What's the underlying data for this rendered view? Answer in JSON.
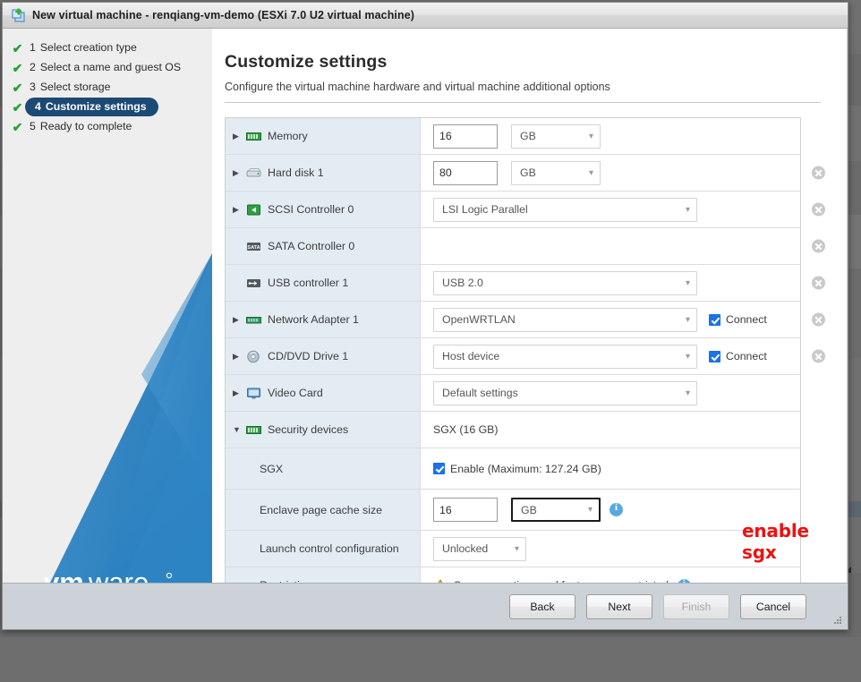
{
  "window": {
    "title": "New virtual machine - renqiang-vm-demo (ESXi 7.0 U2 virtual machine)",
    "icon": "new-virtual-machine-icon"
  },
  "nav": {
    "steps": [
      {
        "num": "1",
        "label": "Select creation type",
        "done": true,
        "active": false
      },
      {
        "num": "2",
        "label": "Select a name and guest OS",
        "done": true,
        "active": false
      },
      {
        "num": "3",
        "label": "Select storage",
        "done": true,
        "active": false
      },
      {
        "num": "4",
        "label": "Customize settings",
        "done": true,
        "active": true
      },
      {
        "num": "5",
        "label": "Ready to complete",
        "done": false,
        "active": false
      }
    ],
    "logo": "vmware",
    "logo_registered": "®"
  },
  "page": {
    "title": "Customize settings",
    "subtitle": "Configure the virtual machine hardware and virtual machine additional options"
  },
  "annotation": {
    "text": "enable sgx",
    "color": "#ee1111"
  },
  "hardware": [
    {
      "id": "memory",
      "label": "Memory",
      "icon": "memory-module-icon",
      "twisty": "collapsed",
      "control": "number-unit",
      "value": "16",
      "unit": "GB",
      "removable": false
    },
    {
      "id": "hard-disk-1",
      "label": "Hard disk 1",
      "icon": "hard-disk-icon",
      "twisty": "collapsed",
      "control": "number-unit",
      "value": "80",
      "unit": "GB",
      "removable": true
    },
    {
      "id": "scsi-controller-0",
      "label": "SCSI Controller 0",
      "icon": "scsi-controller-icon",
      "twisty": "collapsed",
      "control": "select-wide",
      "value": "LSI Logic Parallel",
      "removable": true
    },
    {
      "id": "sata-controller-0",
      "label": "SATA Controller 0",
      "icon": "sata-controller-icon",
      "twisty": "none",
      "control": "none",
      "removable": true
    },
    {
      "id": "usb-controller-1",
      "label": "USB controller 1",
      "icon": "usb-controller-icon",
      "twisty": "none",
      "control": "select-wide",
      "value": "USB 2.0",
      "removable": true
    },
    {
      "id": "network-adapter-1",
      "label": "Network Adapter 1",
      "icon": "network-adapter-icon",
      "twisty": "collapsed",
      "control": "select-connect",
      "value": "OpenWRTLAN",
      "connect_label": "Connect",
      "connect_checked": true,
      "removable": true
    },
    {
      "id": "cd-dvd-drive-1",
      "label": "CD/DVD Drive 1",
      "icon": "cd-dvd-drive-icon",
      "twisty": "collapsed",
      "control": "select-connect",
      "value": "Host device",
      "connect_label": "Connect",
      "connect_checked": true,
      "removable": true
    },
    {
      "id": "video-card",
      "label": "Video Card",
      "icon": "video-card-icon",
      "twisty": "collapsed",
      "control": "select-wide",
      "value": "Default settings",
      "removable": false
    },
    {
      "id": "security-devices",
      "label": "Security devices",
      "icon": "security-device-icon",
      "twisty": "expanded",
      "control": "plain-text",
      "value": "SGX (16 GB)",
      "removable": false
    }
  ],
  "sgx": {
    "rows": [
      {
        "id": "sgx",
        "label": "SGX",
        "control": "checkbox",
        "checkbox_label": "Enable (Maximum: 127.24 GB)",
        "checked": true
      },
      {
        "id": "enclave-page-cache-size",
        "label": "Enclave page cache size",
        "control": "number-unit-info",
        "value": "16",
        "unit": "GB",
        "unit_focused": true
      },
      {
        "id": "launch-control-configuration",
        "label": "Launch control configuration",
        "control": "select-lock",
        "value": "Unlocked"
      },
      {
        "id": "restrictions",
        "label": "Restrictions",
        "control": "warning-info",
        "value": "Some operations and features are restricted"
      }
    ]
  },
  "footer": {
    "buttons": [
      {
        "id": "back",
        "label": "Back",
        "disabled": false
      },
      {
        "id": "next",
        "label": "Next",
        "disabled": false
      },
      {
        "id": "finish",
        "label": "Finish",
        "disabled": true
      },
      {
        "id": "cancel",
        "label": "Cancel",
        "disabled": false
      }
    ]
  }
}
